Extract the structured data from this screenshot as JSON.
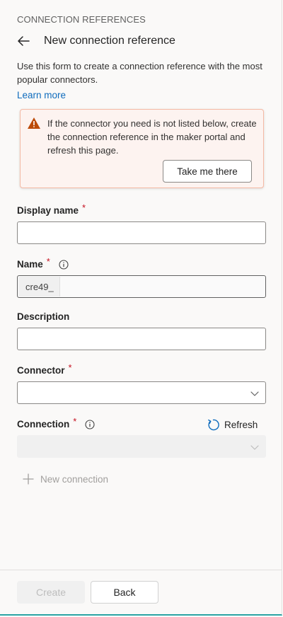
{
  "panel": {
    "section_label": "CONNECTION REFERENCES",
    "title": "New connection reference",
    "description": "Use this form to create a connection reference with the most popular connectors.",
    "learn_more": "Learn more"
  },
  "warning": {
    "text": "If the connector you need is not listed below, create the connection reference in the maker portal and refresh this page.",
    "button_label": "Take me there"
  },
  "form": {
    "display_name": {
      "label": "Display name",
      "required_marker": "*",
      "value": ""
    },
    "name": {
      "label": "Name",
      "required_marker": "*",
      "prefix": "cre49_",
      "value": ""
    },
    "description": {
      "label": "Description",
      "value": ""
    },
    "connector": {
      "label": "Connector",
      "required_marker": "*",
      "selected": ""
    },
    "connection": {
      "label": "Connection",
      "required_marker": "*",
      "selected": "",
      "refresh_label": "Refresh"
    },
    "new_connection_label": "New connection"
  },
  "footer": {
    "create_label": "Create",
    "back_label": "Back"
  },
  "colors": {
    "accent": "#0f6cbd",
    "required": "#c50f1f",
    "warning_icon": "#bc4b09",
    "warning_bg": "#fdf3f0",
    "warning_border": "#f4b9a4"
  },
  "icons": [
    "arrow-left-icon",
    "warning-icon",
    "info-icon",
    "chevron-down-icon",
    "refresh-icon",
    "plus-icon"
  ]
}
